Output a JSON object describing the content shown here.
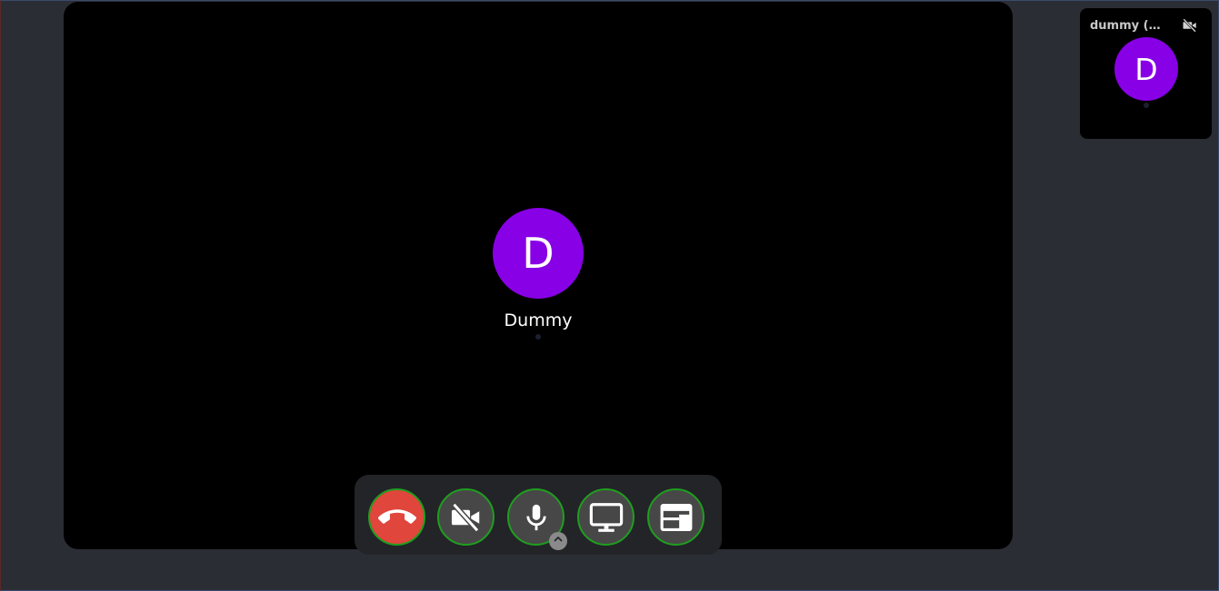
{
  "main_video": {
    "participant_name": "Dummy",
    "avatar_initial": "D",
    "avatar_color": "#8800e6"
  },
  "self_view": {
    "name": "dummy (you)",
    "avatar_initial": "D",
    "avatar_color": "#8800e6",
    "camera_icon": "camera-off-icon"
  },
  "toolbar": {
    "buttons": [
      {
        "name": "end-call-button",
        "icon": "phone-hangup-icon",
        "color": "#e0463c"
      },
      {
        "name": "camera-toggle-button",
        "icon": "camera-off-icon"
      },
      {
        "name": "microphone-button",
        "icon": "microphone-icon"
      },
      {
        "name": "screen-share-button",
        "icon": "monitor-icon"
      },
      {
        "name": "layout-button",
        "icon": "layout-icon"
      }
    ],
    "active_border_color": "#1f9e1f",
    "mic_options_icon": "chevron-up-icon"
  }
}
